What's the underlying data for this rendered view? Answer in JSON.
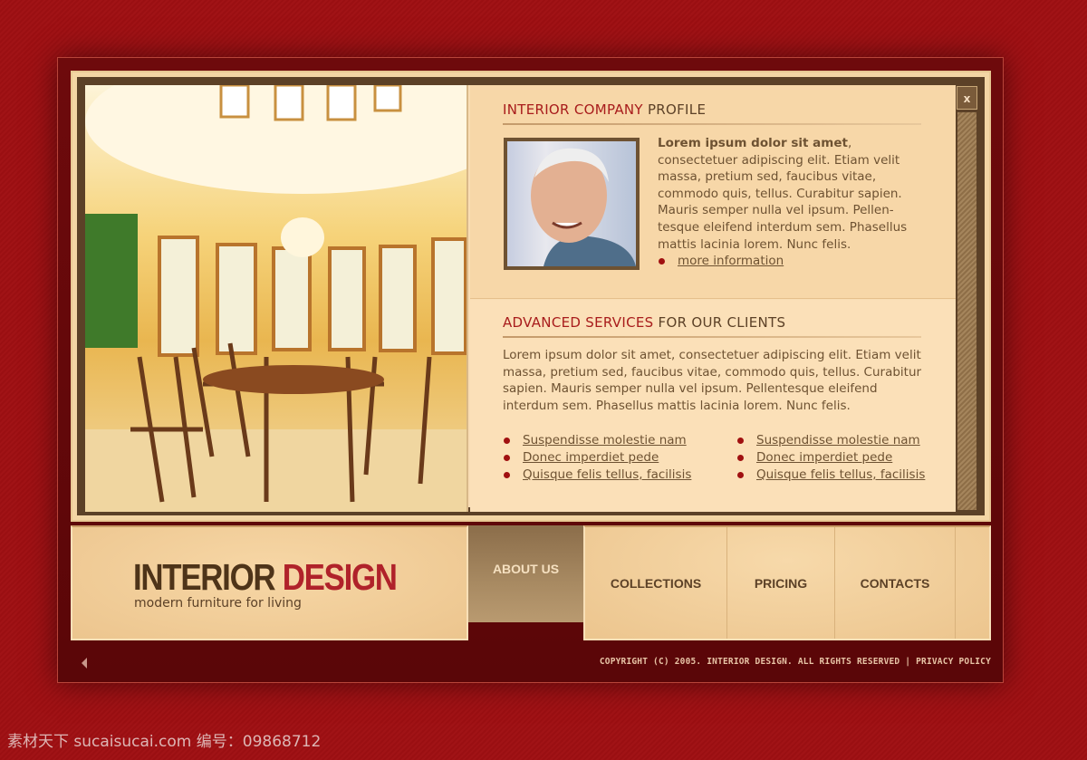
{
  "profile": {
    "title_accent": "INTERIOR COMPANY",
    "title_rest": " PROFILE",
    "lead": "Lorem ipsum dolor sit amet",
    "lead_comma": ",",
    "body": "consectetuer adipiscing elit. Etiam velit massa, pretium sed, faucibus vitae, commodo quis, tellus. Curabitur sapien. Mauris semper nulla vel ipsum. Pellen-tesque eleifend interdum sem. Phasellus mattis lacinia lorem. Nunc felis.",
    "more_link": "more information"
  },
  "services": {
    "title_accent": "ADVANCED SERVICES",
    "title_rest": " FOR OUR CLIENTS",
    "body": "Lorem ipsum dolor sit amet, consectetuer adipiscing elit. Etiam velit massa, pretium sed, faucibus vitae, commodo quis, tellus. Curabitur sapien. Mauris semper nulla vel ipsum. Pellentesque eleifend interdum sem. Phasellus mattis lacinia lorem. Nunc felis.",
    "links_left": [
      "Suspendisse molestie nam",
      "Donec imperdiet pede",
      "Quisque felis tellus, facilisis"
    ],
    "links_right": [
      "Suspendisse molestie nam",
      "Donec imperdiet pede",
      "Quisque felis tellus, facilisis"
    ]
  },
  "close_label": "x",
  "logo": {
    "word1": "INTERIOR",
    "word2": "DESIGN",
    "tagline": "modern furniture for living"
  },
  "nav": {
    "active": "ABOUT US",
    "items": [
      "COLLECTIONS",
      "PRICING",
      "CONTACTS"
    ]
  },
  "footer": {
    "copyright": "COPYRIGHT (C) 2005. INTERIOR DESIGN. ALL RIGHTS RESERVED",
    "privacy": "PRIVACY POLICY"
  },
  "watermark": "素材天下 sucaisucai.com  编号：09868712",
  "colors": {
    "background": "#9a0f12",
    "accent_red": "#a81c1c",
    "brown": "#5c4127",
    "beige": "#f7d7a8"
  }
}
